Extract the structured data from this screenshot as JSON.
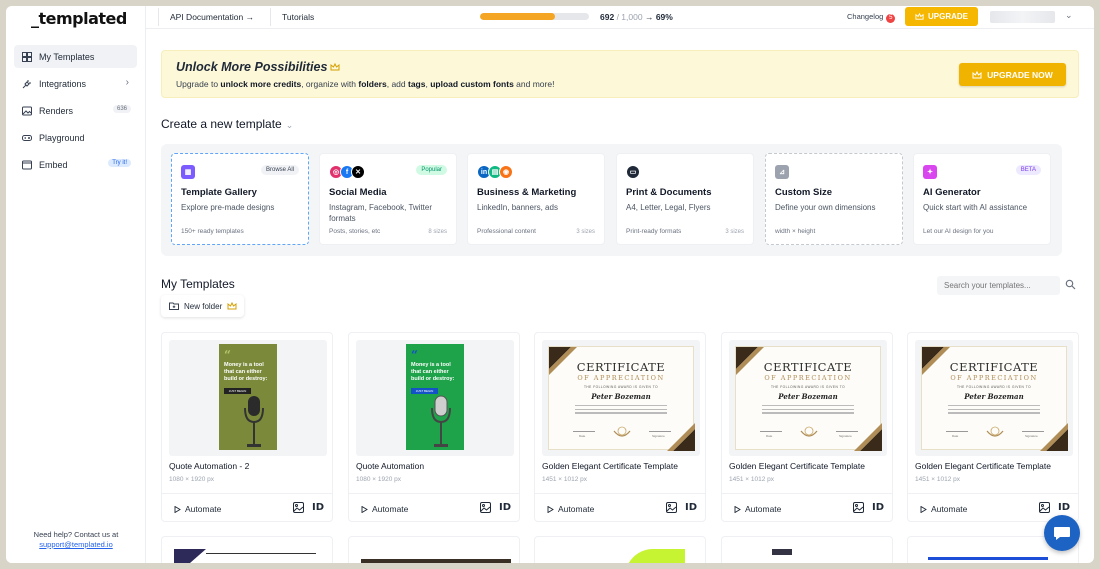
{
  "sidebar": {
    "logo": "_templated",
    "items": [
      {
        "label": "My Templates",
        "icon": "grid-icon"
      },
      {
        "label": "Integrations",
        "icon": "plug-icon"
      },
      {
        "label": "Renders",
        "icon": "image-icon",
        "count": "636"
      },
      {
        "label": "Playground",
        "icon": "gamepad-icon"
      },
      {
        "label": "Embed",
        "icon": "embed-icon",
        "badge": "Try it!"
      }
    ],
    "help_text": "Need help? Contact us at",
    "help_email": "support@templated.io"
  },
  "topbar": {
    "api_docs": "API Documentation",
    "tutorials": "Tutorials",
    "credits_used": "692",
    "credits_total": "/ 1,000",
    "credits_percent": "69%",
    "credits_fraction": 0.69,
    "changelog": "Changelog",
    "changelog_count": "5",
    "upgrade": "UPGRADE"
  },
  "banner": {
    "title": "Unlock More Possibilities",
    "text_parts": [
      "Upgrade to ",
      "unlock more credits",
      ", organize with ",
      "folders",
      ", add ",
      "tags",
      ", ",
      "upload custom fonts",
      " and more!"
    ],
    "button": "UPGRADE NOW"
  },
  "create": {
    "title": "Create a new template",
    "cards": [
      {
        "title": "Template Gallery",
        "desc": "Explore pre-made designs",
        "foot": "150+ ready templates",
        "tag": "Browse All",
        "count": ""
      },
      {
        "title": "Social Media",
        "desc": "Instagram, Facebook, Twitter formats",
        "foot": "Posts, stories, etc",
        "tag": "Popular",
        "count": "8 sizes"
      },
      {
        "title": "Business & Marketing",
        "desc": "LinkedIn, banners, ads",
        "foot": "Professional content",
        "tag": "",
        "count": "3 sizes"
      },
      {
        "title": "Print & Documents",
        "desc": "A4, Letter, Legal, Flyers",
        "foot": "Print-ready formats",
        "tag": "",
        "count": "3 sizes"
      },
      {
        "title": "Custom Size",
        "desc": "Define your own dimensions",
        "foot": "width × height",
        "tag": "",
        "count": ""
      },
      {
        "title": "AI Generator",
        "desc": "Quick start with AI assistance",
        "foot": "Let our AI design for you",
        "tag": "BETA",
        "count": ""
      }
    ]
  },
  "templates": {
    "title": "My Templates",
    "search_placeholder": "Search your templates...",
    "new_folder": "New folder",
    "automate": "Automate",
    "id_label": "ID",
    "items": [
      {
        "name": "Quote Automation - 2",
        "size": "1080 × 1920 px"
      },
      {
        "name": "Quote Automation",
        "size": "1080 × 1920 px"
      },
      {
        "name": "Golden Elegant Certificate Template",
        "size": "1451 × 1012 px"
      },
      {
        "name": "Golden Elegant Certificate Template",
        "size": "1451 × 1012 px"
      },
      {
        "name": "Golden Elegant Certificate Template",
        "size": "1451 × 1012 px"
      }
    ],
    "quote_text": "Money is a tool that can either build or destroy:",
    "quote_button": "JUST BEGIN",
    "cert_title": "CERTIFICATE",
    "cert_sub": "OF APPRECIATION",
    "cert_given": "THE FOLLOWING AWARD IS GIVEN TO",
    "cert_name": "Peter Bozeman",
    "cert_date_label": "Date",
    "cert_sign_label": "Signature"
  },
  "colors": {
    "accent_yellow": "#f5b700",
    "primary_blue": "#1d63c4"
  }
}
